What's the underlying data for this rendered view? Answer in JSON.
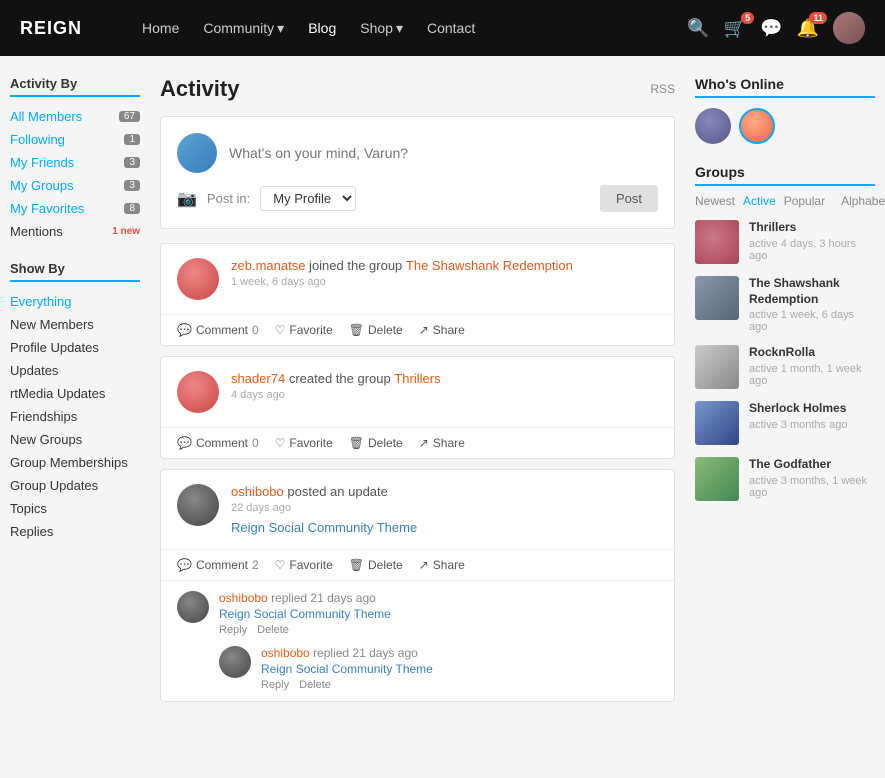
{
  "navbar": {
    "brand": "REIGN",
    "links": [
      {
        "label": "Home",
        "active": false
      },
      {
        "label": "Community",
        "active": true,
        "dropdown": true
      },
      {
        "label": "Blog",
        "active": false
      },
      {
        "label": "Shop",
        "active": false,
        "dropdown": true
      },
      {
        "label": "Contact",
        "active": false
      }
    ],
    "icons": {
      "search": "🔍",
      "cart": "🛒",
      "cart_count": "5",
      "chat": "💬",
      "bell": "🔔",
      "bell_count": "11"
    }
  },
  "sidebar_left": {
    "activity_by_title": "Activity By",
    "activity_items": [
      {
        "label": "All Members",
        "count": "67",
        "active": true
      },
      {
        "label": "Following",
        "count": "1",
        "active": false
      },
      {
        "label": "My Friends",
        "count": "3",
        "active": false
      },
      {
        "label": "My Groups",
        "count": "3",
        "active": false
      },
      {
        "label": "My Favorites",
        "count": "8",
        "active": false
      },
      {
        "label": "Mentions",
        "count": null,
        "new": true,
        "new_label": "1 new"
      }
    ],
    "show_by_title": "Show By",
    "show_items": [
      {
        "label": "Everything",
        "active": true
      },
      {
        "label": "New Members",
        "active": false
      },
      {
        "label": "Profile Updates",
        "active": false
      },
      {
        "label": "Updates",
        "active": false
      },
      {
        "label": "rtMedia Updates",
        "active": false
      },
      {
        "label": "Friendships",
        "active": false
      },
      {
        "label": "New Groups",
        "active": false
      },
      {
        "label": "Group Memberships",
        "active": false
      },
      {
        "label": "Group Updates",
        "active": false
      },
      {
        "label": "Topics",
        "active": false
      },
      {
        "label": "Replies",
        "active": false
      }
    ]
  },
  "main": {
    "title": "Activity",
    "rss": "RSS",
    "post_placeholder": "What's on your mind, Varun?",
    "post_in_label": "Post in:",
    "post_in_value": "My Profile",
    "post_button": "Post",
    "activities": [
      {
        "username": "zeb.manatse",
        "action": " joined the group ",
        "target": "The Shawshank Redemption",
        "time": "1 week, 6 days ago",
        "avatar_class": "avatar-red",
        "comment_count": "0",
        "actions": [
          "Comment",
          "Favorite",
          "Delete",
          "Share"
        ]
      },
      {
        "username": "shader74",
        "action": " created the group ",
        "target": "Thrillers",
        "time": "4 days ago",
        "avatar_class": "avatar-red",
        "comment_count": "0",
        "actions": [
          "Comment",
          "Favorite",
          "Delete",
          "Share"
        ]
      },
      {
        "username": "oshibobo",
        "action": " posted an update",
        "target": "",
        "time": "22 days ago",
        "avatar_class": "avatar-dark",
        "comment_count": "2",
        "update_text": "Reign Social Community Theme",
        "actions": [
          "Comment",
          "Favorite",
          "Delete",
          "Share"
        ],
        "replies": [
          {
            "username": "oshibobo",
            "action": " replied ",
            "time": "21 days ago",
            "text": "Reign Social Community Theme",
            "links": [
              "Reply",
              "Delete"
            ],
            "nested": {
              "username": "oshibobo",
              "action": " replied ",
              "time": "21 days ago",
              "text": "Reign Social Community Theme",
              "links": [
                "Reply",
                "Delete"
              ]
            }
          }
        ]
      }
    ]
  },
  "sidebar_right": {
    "whos_online_title": "Who's Online",
    "groups_title": "Groups",
    "groups_filters": [
      {
        "label": "Newest",
        "active": false
      },
      {
        "label": "Active",
        "active": true
      },
      {
        "label": "Popular",
        "active": false
      },
      {
        "label": "Alphabetical",
        "active": false
      }
    ],
    "groups": [
      {
        "name": "Thrillers",
        "time": "active 4 days, 3 hours ago",
        "thumb": "group-thumb-1"
      },
      {
        "name": "The Shawshank Redemption",
        "time": "active 1 week, 6 days ago",
        "thumb": "group-thumb-2"
      },
      {
        "name": "RocknRolla",
        "time": "active 1 month, 1 week ago",
        "thumb": "group-thumb-3"
      },
      {
        "name": "Sherlock Holmes",
        "time": "active 3 months ago",
        "thumb": "group-thumb-4"
      },
      {
        "name": "The Godfather",
        "time": "active 3 months, 1 week ago",
        "thumb": "group-thumb-5"
      }
    ]
  }
}
